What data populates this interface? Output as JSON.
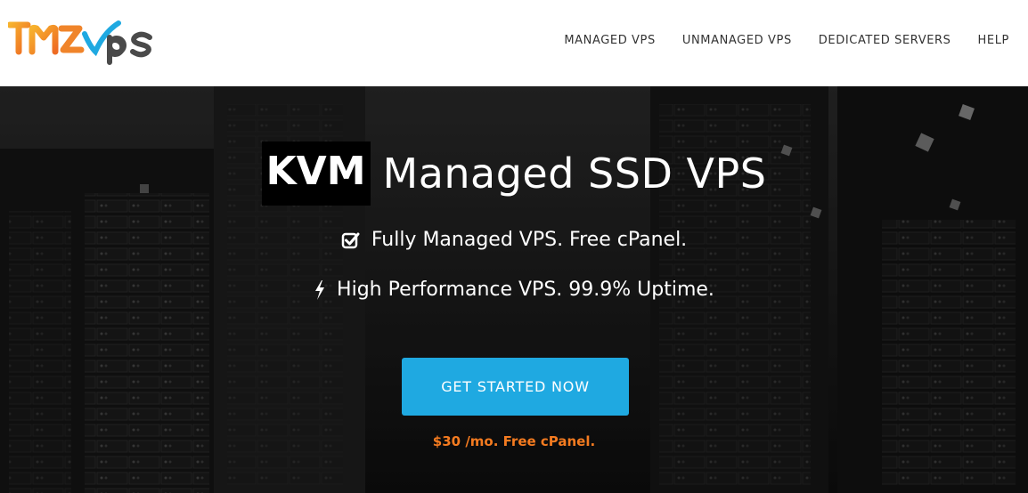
{
  "header": {
    "logo_text": "TMZVPS",
    "nav": [
      {
        "label": "MANAGED VPS"
      },
      {
        "label": "UNMANAGED VPS"
      },
      {
        "label": "DEDICATED SERVERS"
      },
      {
        "label": "HELP"
      }
    ]
  },
  "hero": {
    "headline_highlight": "KVM",
    "headline_rest": "Managed SSD VPS",
    "features": [
      {
        "icon": "checkbox-icon",
        "text": "Fully Managed VPS. Free cPanel."
      },
      {
        "icon": "lightning-icon",
        "text": "High Performance VPS. 99.9% Uptime."
      }
    ],
    "cta_label": "GET STARTED NOW",
    "price_note": "$30 /mo. Free cPanel."
  },
  "colors": {
    "accent": "#1fa9e1",
    "price": "#f47b20",
    "logo_orange": "#f39221",
    "logo_gray": "#4a4a4a",
    "logo_blue": "#1fa9e1"
  }
}
